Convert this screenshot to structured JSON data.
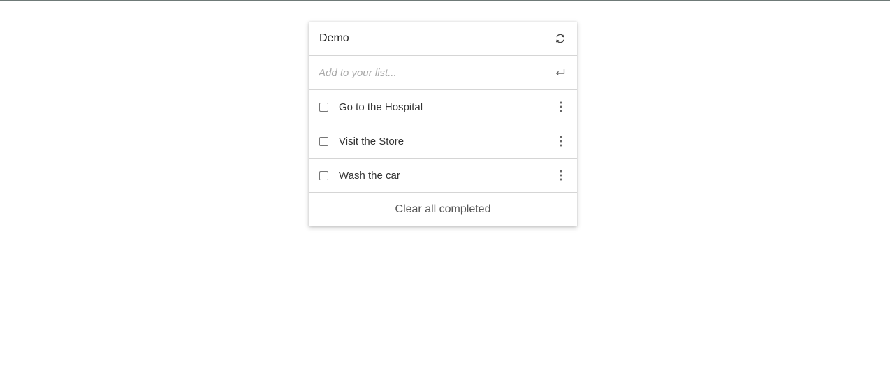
{
  "header": {
    "title": "Demo",
    "refresh_icon": "refresh-icon"
  },
  "add_item": {
    "placeholder": "Add to your list...",
    "value": "",
    "submit_icon": "enter-return-icon"
  },
  "items": [
    {
      "label": "Go to the Hospital",
      "checked": false,
      "menu_icon": "more-vertical-icon"
    },
    {
      "label": "Visit the Store",
      "checked": false,
      "menu_icon": "more-vertical-icon"
    },
    {
      "label": "Wash the car",
      "checked": false,
      "menu_icon": "more-vertical-icon"
    }
  ],
  "footer": {
    "clear_label": "Clear all completed"
  }
}
